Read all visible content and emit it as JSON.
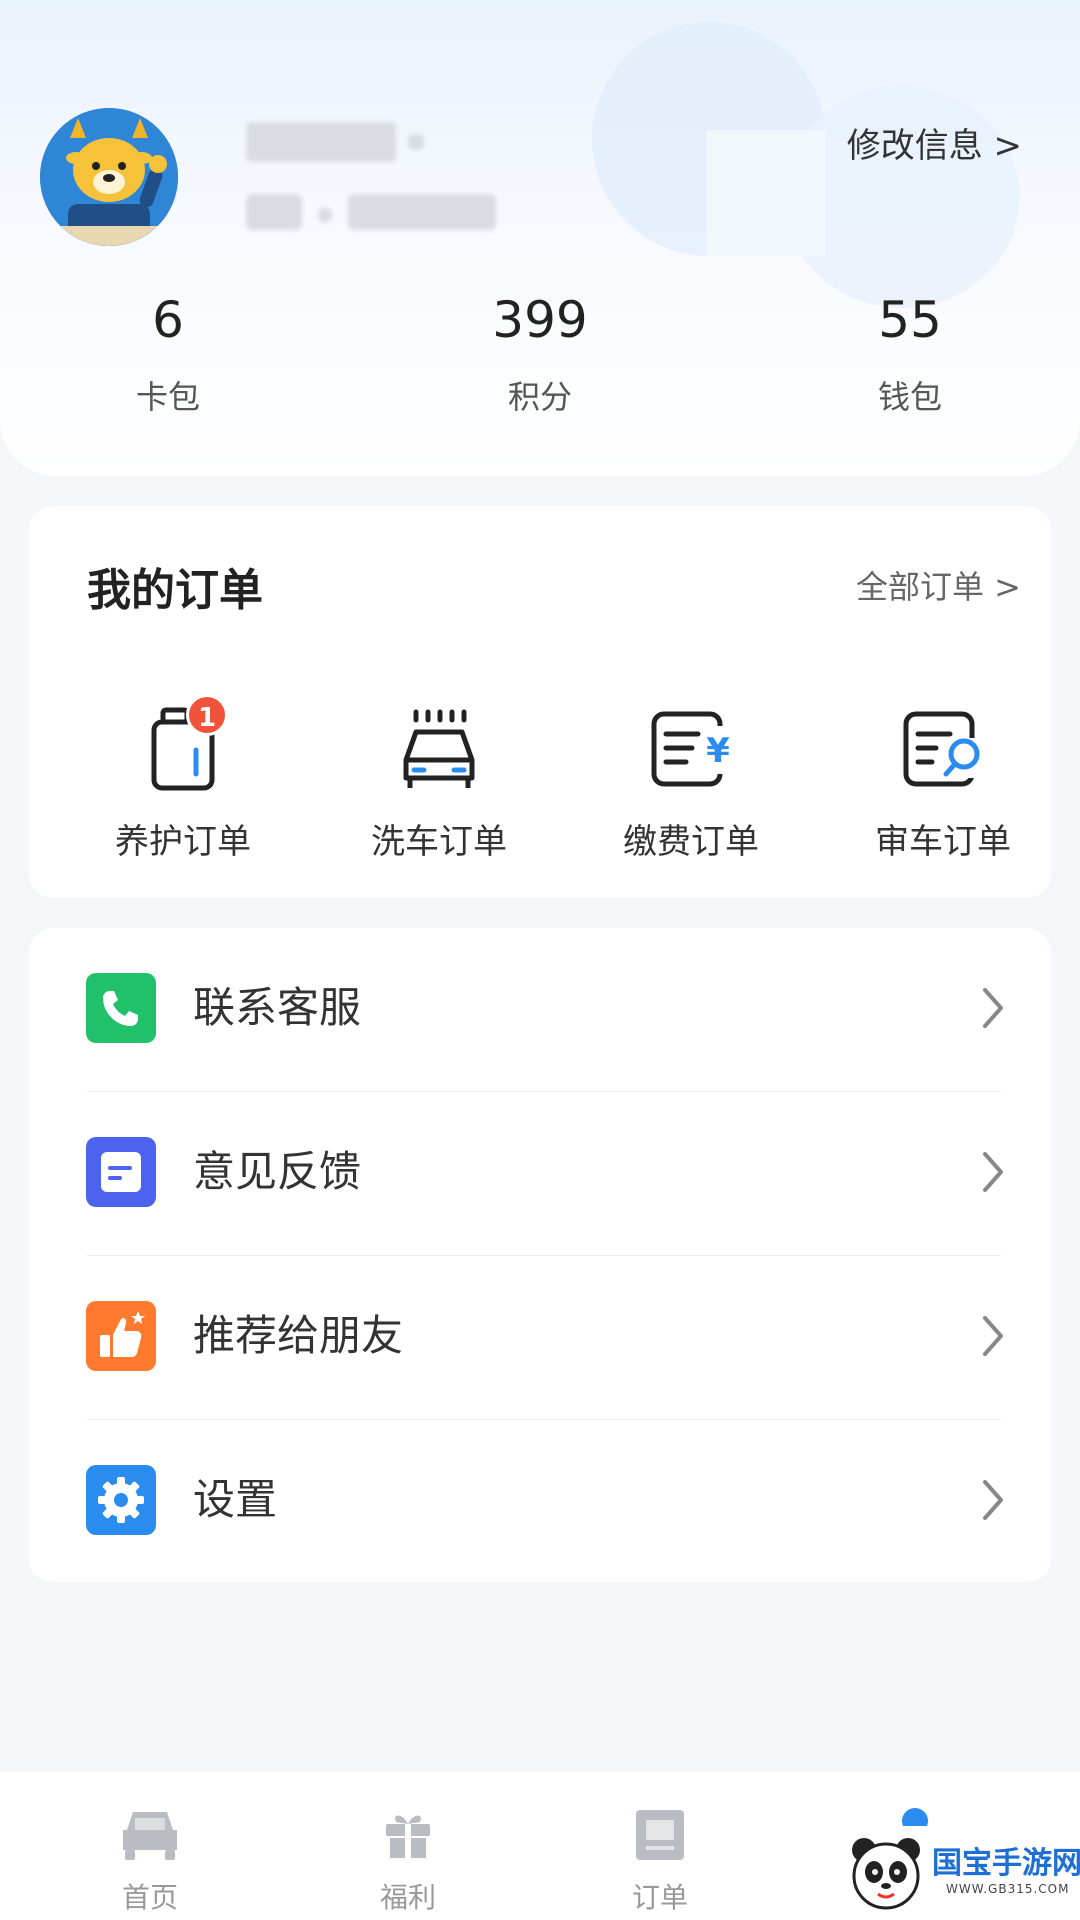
{
  "profile": {
    "edit_label": "修改信息 >"
  },
  "stats": [
    {
      "value": "6",
      "label": "卡包"
    },
    {
      "value": "399",
      "label": "积分"
    },
    {
      "value": "55",
      "label": "钱包"
    }
  ],
  "orders": {
    "title": "我的订单",
    "all_label": "全部订单 >",
    "items": [
      {
        "label": "养护订单",
        "badge": "1",
        "icon": "oil-can-icon"
      },
      {
        "label": "洗车订单",
        "icon": "car-wash-icon"
      },
      {
        "label": "缴费订单",
        "icon": "payment-bill-icon"
      },
      {
        "label": "审车订单",
        "icon": "inspection-search-icon"
      }
    ]
  },
  "menu": [
    {
      "label": "联系客服",
      "icon": "phone-icon",
      "color": "#21c06b"
    },
    {
      "label": "意见反馈",
      "icon": "feedback-icon",
      "color": "#4b63ef"
    },
    {
      "label": "推荐给朋友",
      "icon": "thumbs-up-icon",
      "color": "#ff7a2e"
    },
    {
      "label": "设置",
      "icon": "gear-icon",
      "color": "#2b8cf0"
    }
  ],
  "tabbar": [
    {
      "label": "首页",
      "icon": "car-icon"
    },
    {
      "label": "福利",
      "icon": "gift-icon"
    },
    {
      "label": "订单",
      "icon": "order-icon"
    }
  ],
  "watermark": {
    "text": "国宝手游网",
    "url": "WWW.GB315.COM"
  }
}
